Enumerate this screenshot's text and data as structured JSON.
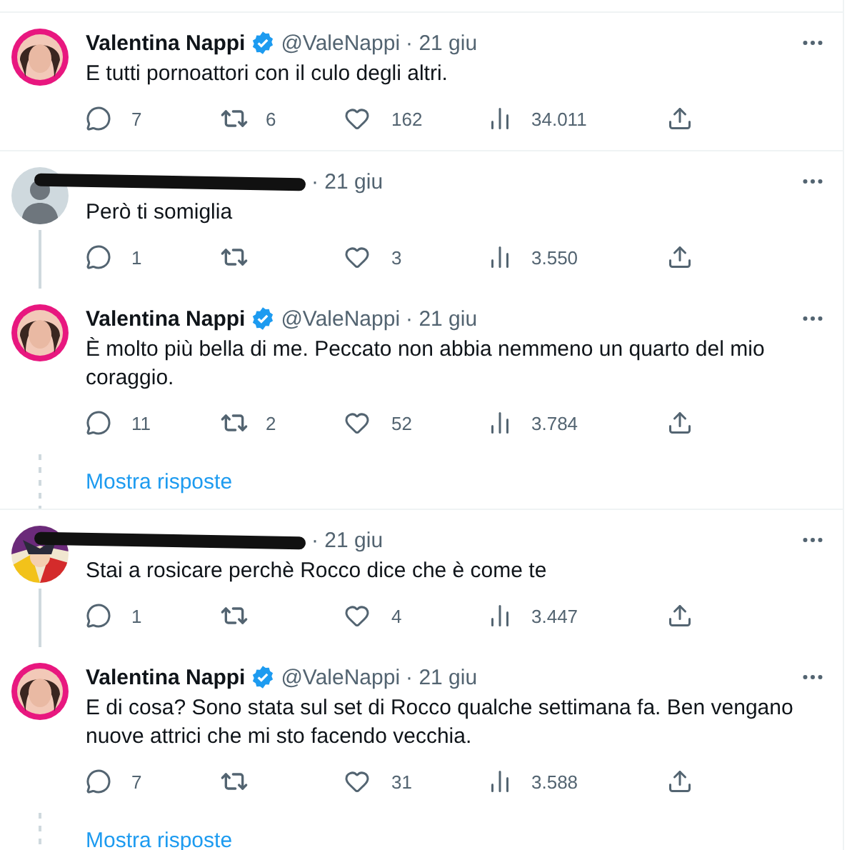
{
  "tweets": [
    {
      "avatar": {
        "kind": "person"
      },
      "redacted": false,
      "name": "Valentina Nappi",
      "verified": true,
      "handle": "@ValeNappi",
      "date": "· 21 giu",
      "text": "E tutti pornoattori con il culo degli altri.",
      "replies": "7",
      "reposts": "6",
      "likes": "162",
      "views": "34.011",
      "thread_below": false,
      "divider_below": true
    },
    {
      "avatar": {
        "kind": "default"
      },
      "redacted": true,
      "date": "· 21 giu",
      "text": "Però ti somiglia",
      "replies": "1",
      "likes": "3",
      "views": "3.550",
      "thread_below": true,
      "divider_below": false
    },
    {
      "avatar": {
        "kind": "person"
      },
      "redacted": false,
      "name": "Valentina Nappi",
      "verified": true,
      "handle": "@ValeNappi",
      "date": "· 21 giu",
      "text": "È molto più bella di me. Peccato non abbia nemmeno un quarto del mio coraggio.",
      "replies": "11",
      "reposts": "2",
      "likes": "52",
      "views": "3.784",
      "thread_below": false,
      "show_replies": "Mostra risposte",
      "divider_below": true
    },
    {
      "avatar": {
        "kind": "cartoon"
      },
      "redacted": true,
      "date": "· 21 giu",
      "text": "Stai a rosicare perchè Rocco dice che è come te",
      "replies": "1",
      "likes": "4",
      "views": "3.447",
      "thread_below": true,
      "divider_below": false
    },
    {
      "avatar": {
        "kind": "person"
      },
      "redacted": false,
      "name": "Valentina Nappi",
      "verified": true,
      "handle": "@ValeNappi",
      "date": "· 21 giu",
      "text": "E di cosa? Sono stata sul set di Rocco qualche settimana fa. Ben vengano nuove attrici che mi sto facendo vecchia.",
      "replies": "7",
      "likes": "31",
      "views": "3.588",
      "thread_below": false,
      "show_replies": "Mostra risposte",
      "divider_below": false
    }
  ]
}
